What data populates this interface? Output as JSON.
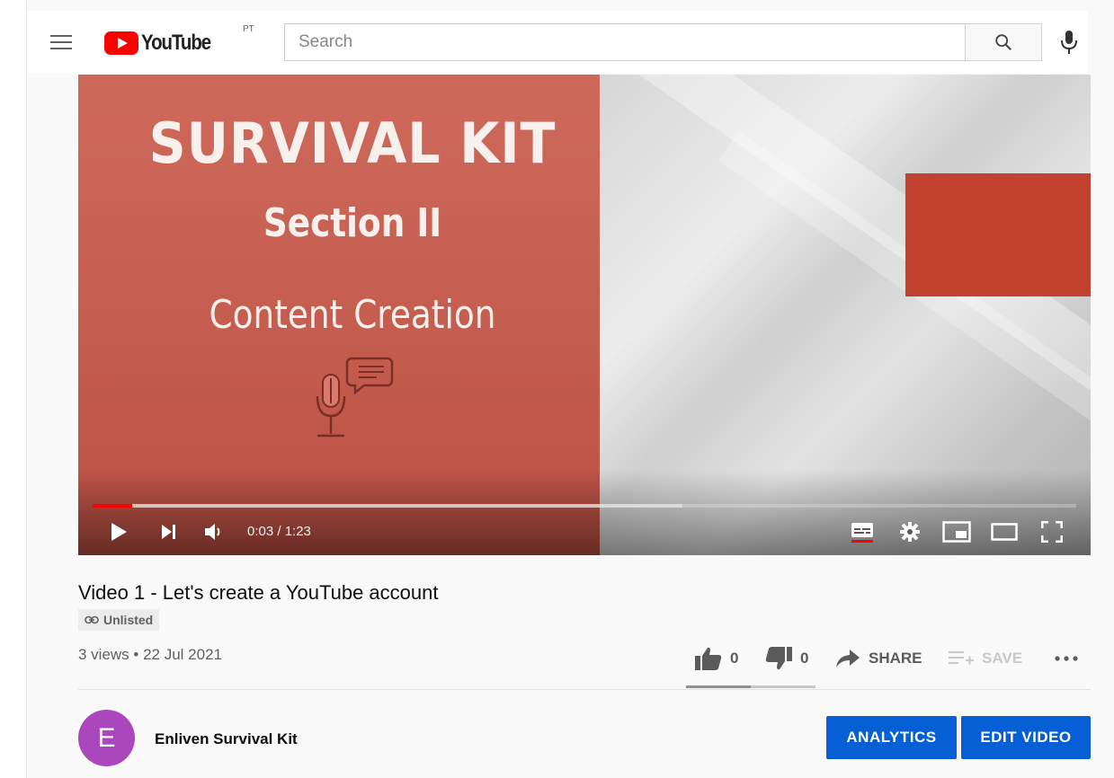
{
  "masthead": {
    "menu_icon": "hamburger-menu-icon",
    "logo_text": "YouTube",
    "country_code": "PT",
    "search_placeholder": "Search",
    "search_icon": "search-icon",
    "mic_icon": "microphone-icon"
  },
  "player": {
    "slide": {
      "title": "SURVIVAL KIT",
      "subtitle": "Section II",
      "topic": "Content Creation"
    },
    "progress": {
      "played_fraction": 0.04,
      "buffered_fraction": 0.6
    },
    "time_display": "0:03 / 1:23",
    "controls": [
      "play-icon",
      "next-icon",
      "volume-icon",
      "subtitles-icon",
      "settings-gear-icon",
      "miniplayer-icon",
      "theater-mode-icon",
      "fullscreen-icon"
    ]
  },
  "video": {
    "title": "Video 1 - Let's create a YouTube account",
    "visibility": "Unlisted",
    "meta": "3 views • 22 Jul 2021",
    "likes": "0",
    "dislikes": "0",
    "share_label": "SHARE",
    "save_label": "SAVE",
    "like_fraction": 0.5
  },
  "channel": {
    "avatar_letter": "E",
    "avatar_color": "#ab47bc",
    "name": "Enliven Survival Kit",
    "analytics_label": "ANALYTICS",
    "edit_label": "EDIT VIDEO"
  },
  "colors": {
    "accent_red": "#ff0000",
    "button_blue": "#065fd4"
  }
}
